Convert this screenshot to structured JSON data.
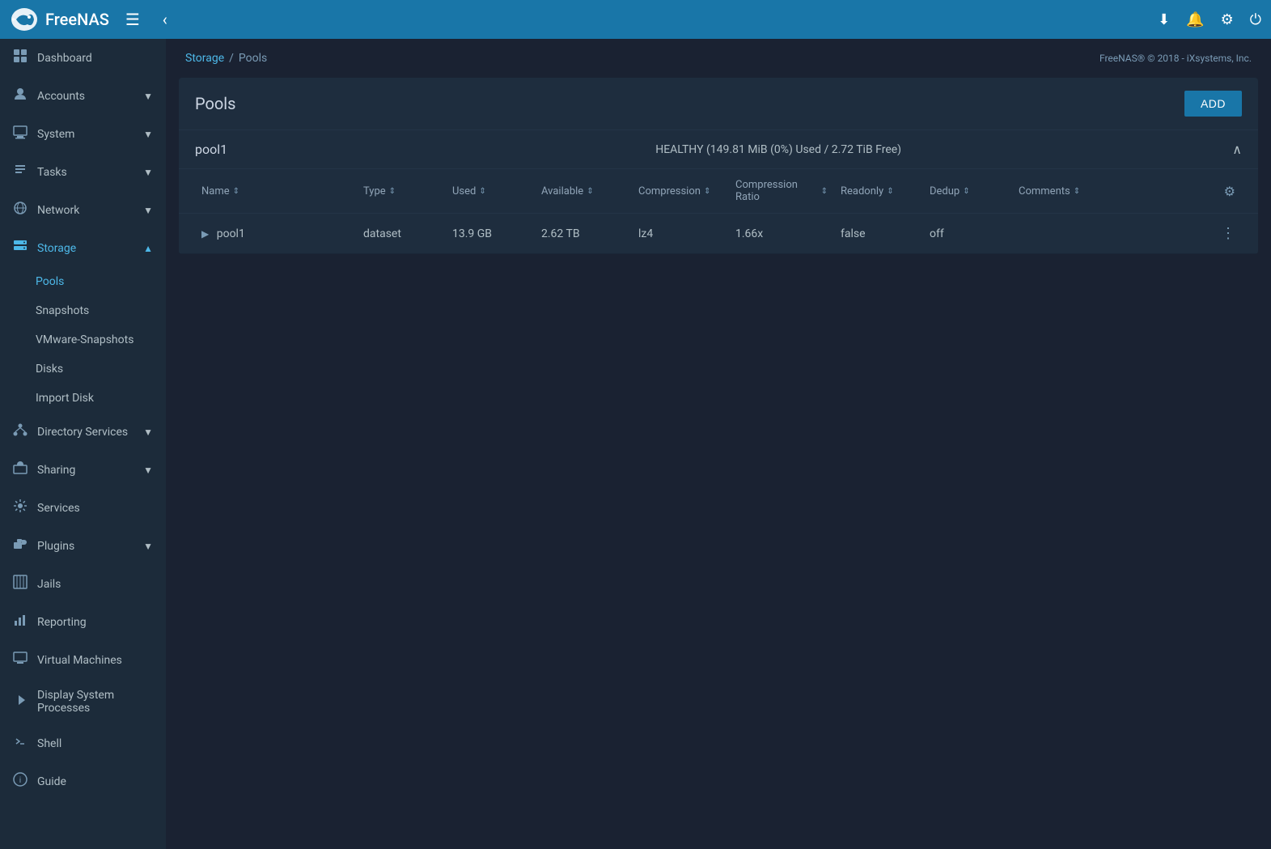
{
  "topbar": {
    "logo_text": "FreeNAS",
    "copyright": "FreeNAS® © 2018 - iXsystems, Inc."
  },
  "breadcrumb": {
    "storage": "Storage",
    "separator": "/",
    "pools": "Pools"
  },
  "sidebar": {
    "items": [
      {
        "id": "dashboard",
        "label": "Dashboard",
        "icon": "⊞",
        "has_arrow": false
      },
      {
        "id": "accounts",
        "label": "Accounts",
        "icon": "👤",
        "has_arrow": true
      },
      {
        "id": "system",
        "label": "System",
        "icon": "🖥",
        "has_arrow": true
      },
      {
        "id": "tasks",
        "label": "Tasks",
        "icon": "📋",
        "has_arrow": true
      },
      {
        "id": "network",
        "label": "Network",
        "icon": "🌐",
        "has_arrow": true
      },
      {
        "id": "storage",
        "label": "Storage",
        "icon": "💾",
        "has_arrow": true,
        "active": true
      }
    ],
    "storage_subitems": [
      {
        "id": "pools",
        "label": "Pools",
        "active": true
      },
      {
        "id": "snapshots",
        "label": "Snapshots"
      },
      {
        "id": "vmware-snapshots",
        "label": "VMware-Snapshots"
      },
      {
        "id": "disks",
        "label": "Disks"
      },
      {
        "id": "import-disk",
        "label": "Import Disk"
      }
    ],
    "bottom_items": [
      {
        "id": "directory-services",
        "label": "Directory Services",
        "icon": "🔗",
        "has_arrow": true
      },
      {
        "id": "sharing",
        "label": "Sharing",
        "icon": "📁",
        "has_arrow": true
      },
      {
        "id": "services",
        "label": "Services",
        "icon": "⚙",
        "has_arrow": false
      },
      {
        "id": "plugins",
        "label": "Plugins",
        "icon": "🧩",
        "has_arrow": true
      },
      {
        "id": "jails",
        "label": "Jails",
        "icon": "⊞",
        "has_arrow": false
      },
      {
        "id": "reporting",
        "label": "Reporting",
        "icon": "📊",
        "has_arrow": false
      },
      {
        "id": "virtual-machines",
        "label": "Virtual Machines",
        "icon": "🖥",
        "has_arrow": false
      },
      {
        "id": "display-system",
        "label": "Display System Processes",
        "icon": "⚡",
        "has_arrow": false
      },
      {
        "id": "shell",
        "label": "Shell",
        "icon": "◁▷",
        "has_arrow": false
      },
      {
        "id": "guide",
        "label": "Guide",
        "icon": "ℹ",
        "has_arrow": false
      }
    ]
  },
  "pools": {
    "title": "Pools",
    "add_button": "ADD",
    "pool1": {
      "name": "pool1",
      "status": "HEALTHY (149.81 MiB (0%) Used / 2.72 TiB Free)"
    },
    "table": {
      "columns": [
        {
          "id": "name",
          "label": "Name"
        },
        {
          "id": "type",
          "label": "Type"
        },
        {
          "id": "used",
          "label": "Used"
        },
        {
          "id": "available",
          "label": "Available"
        },
        {
          "id": "compression",
          "label": "Compression"
        },
        {
          "id": "compression_ratio",
          "label": "Compression Ratio"
        },
        {
          "id": "readonly",
          "label": "Readonly"
        },
        {
          "id": "dedup",
          "label": "Dedup"
        },
        {
          "id": "comments",
          "label": "Comments"
        }
      ],
      "rows": [
        {
          "name": "pool1",
          "expand": true,
          "type": "dataset",
          "used": "13.9 GB",
          "available": "2.62 TB",
          "compression": "lz4",
          "compression_ratio": "1.66x",
          "readonly": "false",
          "dedup": "off",
          "comments": ""
        }
      ]
    }
  }
}
